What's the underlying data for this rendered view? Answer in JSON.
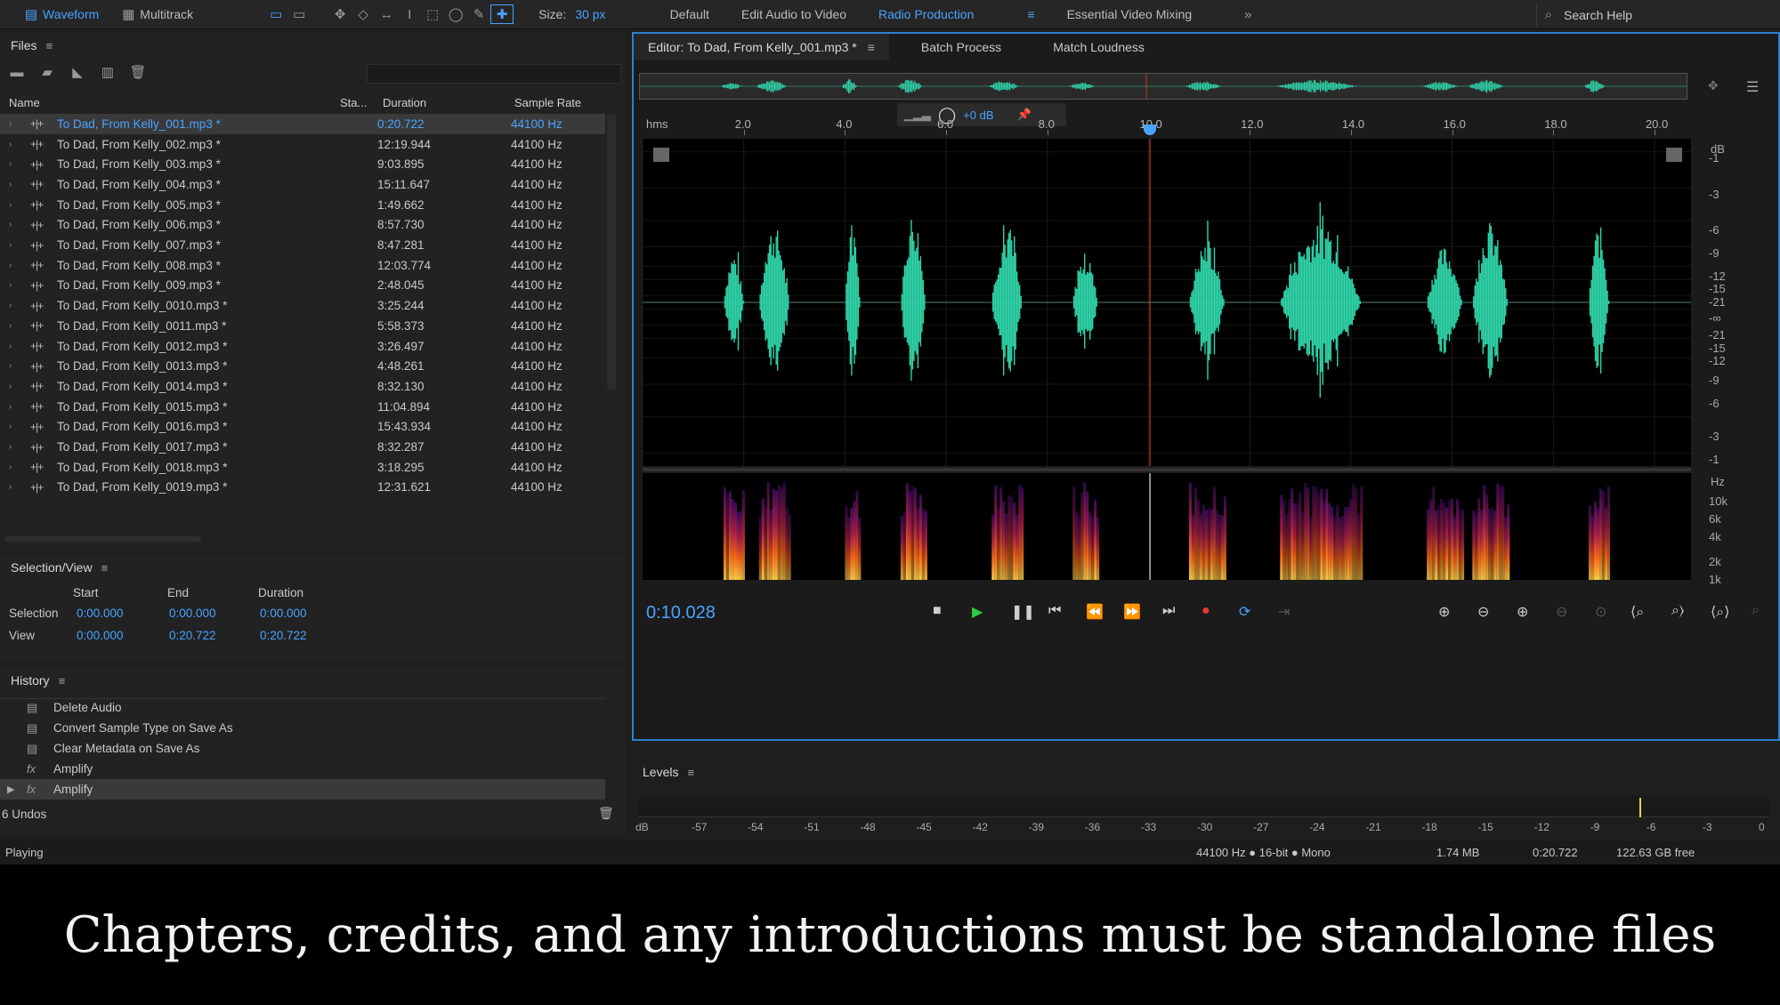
{
  "toolbar": {
    "workspace_waveform": "Waveform",
    "workspace_multitrack": "Multitrack",
    "size_label": "Size:",
    "size_value": "30 px",
    "workspaces": [
      {
        "label": "Default",
        "active": false
      },
      {
        "label": "Edit Audio to Video",
        "active": false
      },
      {
        "label": "Radio Production",
        "active": true
      },
      {
        "label": "Essential Video Mixing",
        "active": false
      }
    ],
    "search_placeholder": "Search Help"
  },
  "files": {
    "title": "Files",
    "columns": {
      "name": "Name",
      "status": "Sta...",
      "duration": "Duration",
      "rate": "Sample Rate"
    },
    "rows": [
      {
        "name": "To Dad, From Kelly_001.mp3 *",
        "duration": "0:20.722",
        "rate": "44100 Hz"
      },
      {
        "name": "To Dad, From Kelly_002.mp3 *",
        "duration": "12:19.944",
        "rate": "44100 Hz"
      },
      {
        "name": "To Dad, From Kelly_003.mp3 *",
        "duration": "9:03.895",
        "rate": "44100 Hz"
      },
      {
        "name": "To Dad, From Kelly_004.mp3 *",
        "duration": "15:11.647",
        "rate": "44100 Hz"
      },
      {
        "name": "To Dad, From Kelly_005.mp3 *",
        "duration": "1:49.662",
        "rate": "44100 Hz"
      },
      {
        "name": "To Dad, From Kelly_006.mp3 *",
        "duration": "8:57.730",
        "rate": "44100 Hz"
      },
      {
        "name": "To Dad, From Kelly_007.mp3 *",
        "duration": "8:47.281",
        "rate": "44100 Hz"
      },
      {
        "name": "To Dad, From Kelly_008.mp3 *",
        "duration": "12:03.774",
        "rate": "44100 Hz"
      },
      {
        "name": "To Dad, From Kelly_009.mp3 *",
        "duration": "2:48.045",
        "rate": "44100 Hz"
      },
      {
        "name": "To Dad, From Kelly_0010.mp3 *",
        "duration": "3:25.244",
        "rate": "44100 Hz"
      },
      {
        "name": "To Dad, From Kelly_0011.mp3 *",
        "duration": "5:58.373",
        "rate": "44100 Hz"
      },
      {
        "name": "To Dad, From Kelly_0012.mp3 *",
        "duration": "3:26.497",
        "rate": "44100 Hz"
      },
      {
        "name": "To Dad, From Kelly_0013.mp3 *",
        "duration": "4:48.261",
        "rate": "44100 Hz"
      },
      {
        "name": "To Dad, From Kelly_0014.mp3 *",
        "duration": "8:32.130",
        "rate": "44100 Hz"
      },
      {
        "name": "To Dad, From Kelly_0015.mp3 *",
        "duration": "11:04.894",
        "rate": "44100 Hz"
      },
      {
        "name": "To Dad, From Kelly_0016.mp3 *",
        "duration": "15:43.934",
        "rate": "44100 Hz"
      },
      {
        "name": "To Dad, From Kelly_0017.mp3 *",
        "duration": "8:32.287",
        "rate": "44100 Hz"
      },
      {
        "name": "To Dad, From Kelly_0018.mp3 *",
        "duration": "3:18.295",
        "rate": "44100 Hz"
      },
      {
        "name": "To Dad, From Kelly_0019.mp3 *",
        "duration": "12:31.621",
        "rate": "44100 Hz"
      }
    ]
  },
  "selview": {
    "title": "Selection/View",
    "headers": {
      "start": "Start",
      "end": "End",
      "duration": "Duration"
    },
    "selection_label": "Selection",
    "selection": {
      "start": "0:00.000",
      "end": "0:00.000",
      "duration": "0:00.000"
    },
    "view_label": "View",
    "view": {
      "start": "0:00.000",
      "end": "0:20.722",
      "duration": "0:20.722"
    }
  },
  "history": {
    "title": "History",
    "items": [
      {
        "label": "Delete Audio"
      },
      {
        "label": "Convert Sample Type on Save As"
      },
      {
        "label": "Clear Metadata on Save As"
      },
      {
        "label": "Amplify"
      },
      {
        "label": "Amplify"
      }
    ],
    "undos": "6 Undos"
  },
  "editor": {
    "tabs": [
      "Editor: To Dad, From Kelly_001.mp3 *",
      "Batch Process",
      "Match Loudness"
    ],
    "hms": "hms",
    "ruler_ticks": [
      "2.0",
      "4.0",
      "6.0",
      "8.0",
      "10.0",
      "12.0",
      "14.0",
      "16.0",
      "18.0",
      "20.0"
    ],
    "hud_gain": "+0 dB",
    "db_unit": "dB",
    "db_ticks": [
      "-1",
      "-3",
      "-6",
      "-9",
      "-12",
      "-15",
      "-21",
      "-∞",
      "-21",
      "-15",
      "-12",
      "-9",
      "-6",
      "-3",
      "-1"
    ],
    "hz_unit": "Hz",
    "hz_ticks": [
      "10k",
      "6k",
      "4k",
      "2k",
      "1k"
    ],
    "current_time": "0:10.028",
    "playhead_seconds": 10.028,
    "duration_seconds": 20.722
  },
  "levels": {
    "title": "Levels",
    "ticks": [
      "dB",
      "-57",
      "-54",
      "-51",
      "-48",
      "-45",
      "-42",
      "-39",
      "-36",
      "-33",
      "-30",
      "-27",
      "-24",
      "-21",
      "-18",
      "-15",
      "-12",
      "-9",
      "-6",
      "-3",
      "0"
    ]
  },
  "status": {
    "state": "Playing",
    "format": "44100 Hz ● 16-bit ● Mono",
    "size": "1.74 MB",
    "duration": "0:20.722",
    "free": "122.63 GB free"
  },
  "subtitle": "Chapters, credits, and any introductions must be standalone files",
  "colors": {
    "accent": "#4aa3ff",
    "waveform": "#2fd3a8",
    "playhead": "#c0392b",
    "record": "#e53935",
    "play": "#2ecc40"
  }
}
